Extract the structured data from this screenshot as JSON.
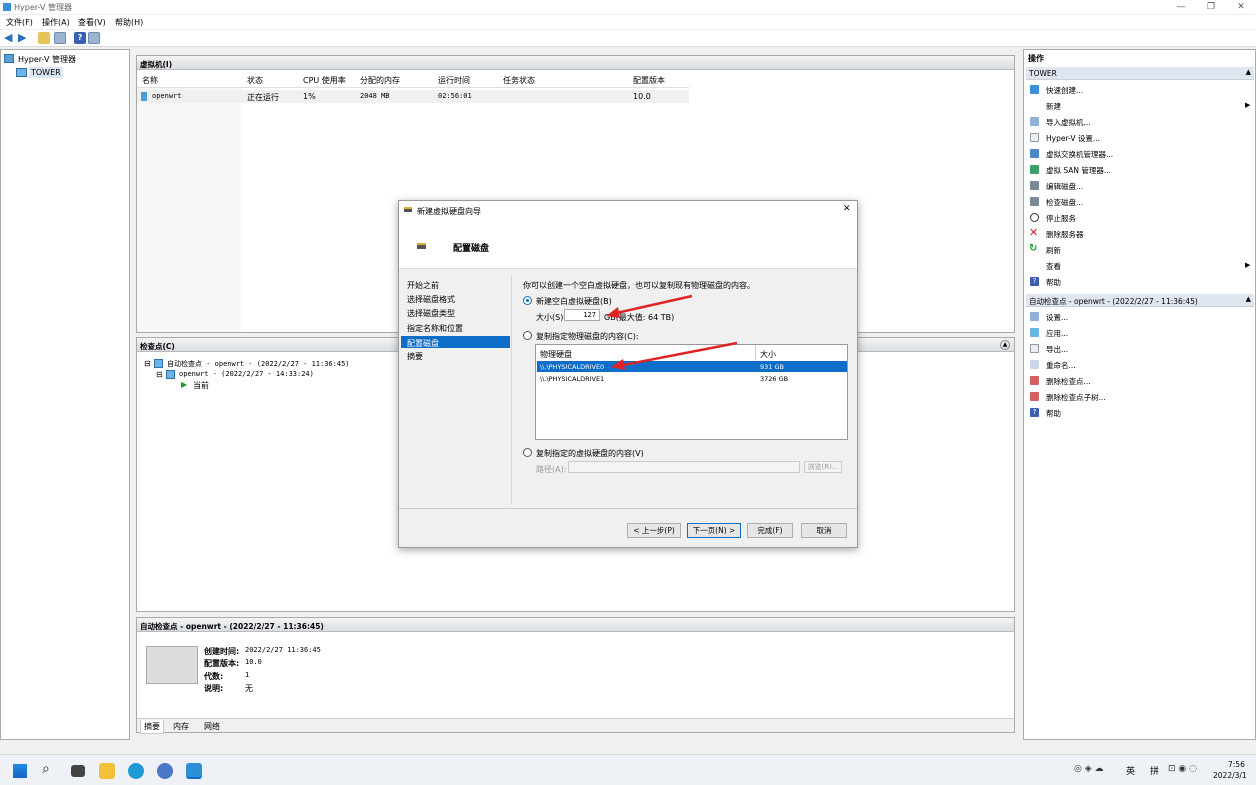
{
  "window": {
    "title": "Hyper-V 管理器"
  },
  "menu": [
    "文件(F)",
    "操作(A)",
    "查看(V)",
    "帮助(H)"
  ],
  "tree": {
    "root": "Hyper-V 管理器",
    "server": "TOWER"
  },
  "vms": {
    "title": "虚拟机(I)",
    "columns": [
      "名称",
      "状态",
      "CPU 使用率",
      "分配的内存",
      "运行时间",
      "任务状态",
      "配置版本"
    ],
    "rows": [
      [
        "openwrt",
        "正在运行",
        "1%",
        "2048 MB",
        "02:56:01",
        "",
        "10.0"
      ]
    ]
  },
  "checkpoints": {
    "title": "检查点(C)",
    "items": [
      "自动检查点 - openwrt - (2022/2/27 - 11:36:45)",
      "openwrt - (2022/2/27 - 14:33:24)",
      "当前"
    ]
  },
  "details": {
    "title": "自动检查点 - openwrt - (2022/2/27 - 11:36:45)",
    "created_label": "创建时间:",
    "created": "2022/2/27 11:36:45",
    "version_label": "配置版本:",
    "version": "10.0",
    "gen_label": "代数:",
    "gen": "1",
    "note_label": "说明:",
    "note": "无",
    "tabs": [
      "摘要",
      "内存",
      "网络"
    ]
  },
  "actions": {
    "title": "操作",
    "section1": "TOWER",
    "items1": [
      "快速创建...",
      "新建",
      "导入虚拟机...",
      "Hyper-V 设置...",
      "虚拟交换机管理器...",
      "虚拟 SAN 管理器...",
      "编辑磁盘...",
      "检查磁盘...",
      "停止服务",
      "删除服务器",
      "刷新",
      "查看",
      "帮助"
    ],
    "section2": "自动检查点 - openwrt - (2022/2/27 - 11:36:45)",
    "items2": [
      "设置...",
      "应用...",
      "导出...",
      "重命名...",
      "删除检查点...",
      "删除检查点子树...",
      "帮助"
    ]
  },
  "dialog": {
    "title": "新建虚拟硬盘向导",
    "heading": "配置磁盘",
    "steps": [
      "开始之前",
      "选择磁盘格式",
      "选择磁盘类型",
      "指定名称和位置",
      "配置磁盘",
      "摘要"
    ],
    "intro": "你可以创建一个空白虚拟硬盘，也可以复制现有物理磁盘的内容。",
    "opt_new": "新建空白虚拟硬盘(B)",
    "size_label": "大小(S):",
    "size_value": "127",
    "size_unit": "GB(最大值: 64 TB)",
    "opt_phys": "复制指定物理磁盘的内容(C):",
    "disk_cols": [
      "物理硬盘",
      "大小"
    ],
    "disks": [
      [
        "\\\\.\\PHYSICALDRIVE0",
        "931 GB"
      ],
      [
        "\\\\.\\PHYSICALDRIVE1",
        "3726 GB"
      ]
    ],
    "opt_virt": "复制指定的虚拟硬盘的内容(V)",
    "path_label": "路径(A):",
    "browse": "浏览(R)...",
    "btn_prev": "< 上一步(P)",
    "btn_next": "下一页(N) >",
    "btn_finish": "完成(F)",
    "btn_cancel": "取消"
  },
  "taskbar": {
    "ime1": "英",
    "ime2": "拼",
    "time": "7:56",
    "date": "2022/3/1"
  }
}
